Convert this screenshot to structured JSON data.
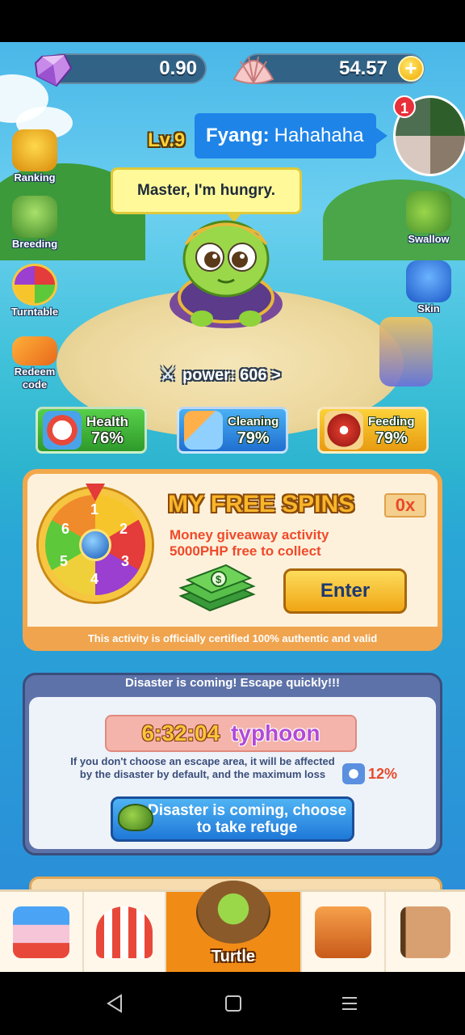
{
  "currency": {
    "gems": "0.90",
    "shells": "54.57",
    "plus": "+"
  },
  "side_menu": {
    "left": [
      {
        "label": "Ranking",
        "icon": "trophy-icon"
      },
      {
        "label": "Breeding",
        "icon": "turtle-egg-icon"
      },
      {
        "label": "Turntable",
        "icon": "wheel-icon"
      },
      {
        "label": "Redeem code",
        "icon": "code-icon"
      }
    ],
    "right": [
      {
        "label": "Swallow",
        "icon": "arrow-turtle-icon"
      },
      {
        "label": "Skin",
        "icon": "shirt-icon"
      }
    ]
  },
  "player": {
    "level": "Lv.9",
    "chat_name": "Fyang:",
    "chat_text": "Hahahaha",
    "notification_count": "1"
  },
  "pet": {
    "speech": "Master, I'm hungry.",
    "power": "power: 606 >"
  },
  "stats": [
    {
      "name": "Health",
      "value": "76%",
      "color": "#3fbb3a",
      "icon": "first-aid-icon"
    },
    {
      "name": "Cleaning",
      "value": "79%",
      "color": "#2f8fe0",
      "icon": "broom-icon"
    },
    {
      "name": "Feeding",
      "value": "79%",
      "color": "#f1b11b",
      "icon": "meat-icon"
    }
  ],
  "free_spins": {
    "title": "MY FREE SPINS",
    "count": "0x",
    "line1": "Money giveaway activity",
    "line2": "5000PHP free to collect",
    "enter": "Enter",
    "footer": "This activity is officially certified 100% authentic and valid",
    "wheel_numbers": [
      "1",
      "2",
      "3",
      "4",
      "5",
      "6"
    ]
  },
  "disaster": {
    "header": "Disaster is coming! Escape quickly!!!",
    "timer": "6:32:04",
    "type": "typhoon",
    "warning": "If you don't choose an escape area, it will be affected by the disaster by default, and the maximum loss",
    "loss": "12%",
    "button": "Disaster is coming, choose to take refuge"
  },
  "bottom_nav": [
    {
      "label": "",
      "icon": "shop-icon"
    },
    {
      "label": "",
      "icon": "circus-tent-icon"
    },
    {
      "label": "Turtle",
      "icon": "turtle-icon",
      "active": true
    },
    {
      "label": "",
      "icon": "backpack-icon"
    },
    {
      "label": "",
      "icon": "contacts-book-icon"
    }
  ]
}
